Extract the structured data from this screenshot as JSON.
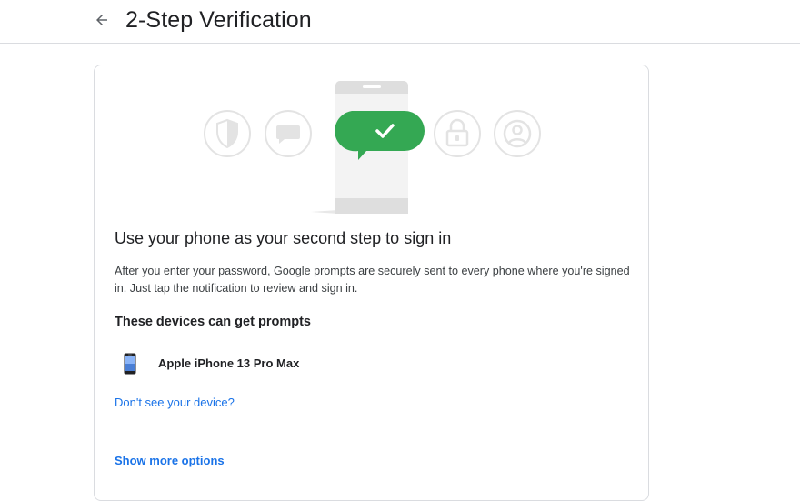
{
  "header": {
    "title": "2-Step Verification",
    "back_icon": "arrow-back-icon"
  },
  "card": {
    "heading": "Use your phone as your second step to sign in",
    "description": "After you enter your password, Google prompts are securely sent to every phone where you're signed in. Just tap the notification to review and sign in.",
    "devices_heading": "These devices can get prompts",
    "devices": [
      {
        "name": "Apple iPhone 13 Pro Max",
        "icon": "smartphone-icon"
      }
    ],
    "missing_device_link": "Don't see your device?",
    "more_options_link": "Show more options"
  },
  "illustration": {
    "icons": [
      "shield-icon",
      "chat-icon",
      "phone-check-icon",
      "lock-icon",
      "account-icon"
    ],
    "check_color": "#34a853"
  },
  "colors": {
    "link": "#1a73e8",
    "border": "#dadce0",
    "text": "#202124"
  }
}
